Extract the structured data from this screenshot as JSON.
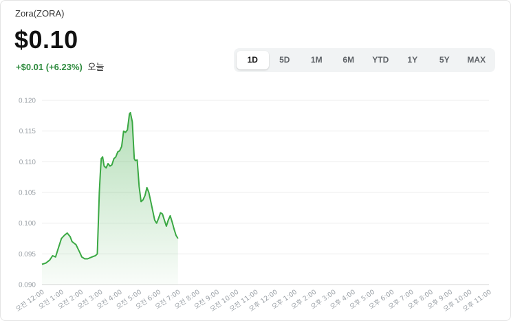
{
  "header": {
    "asset_name": "Zora(ZORA)",
    "price": "$0.10",
    "change": "+$0.01 (+6.23%)",
    "period_label": "오늘"
  },
  "range_tabs": [
    {
      "label": "1D",
      "active": true
    },
    {
      "label": "5D",
      "active": false
    },
    {
      "label": "1M",
      "active": false
    },
    {
      "label": "6M",
      "active": false
    },
    {
      "label": "YTD",
      "active": false
    },
    {
      "label": "1Y",
      "active": false
    },
    {
      "label": "5Y",
      "active": false
    },
    {
      "label": "MAX",
      "active": false
    }
  ],
  "colors": {
    "line": "#3aa843",
    "fill_top": "#3aa843",
    "grid": "#ececec",
    "tick": "#9aa0a6"
  },
  "chart_data": {
    "type": "area",
    "xlabel": "",
    "ylabel": "",
    "ylim": [
      0.09,
      0.12
    ],
    "grid": true,
    "yticks": [
      "0.120",
      "0.115",
      "0.110",
      "0.105",
      "0.100",
      "0.095",
      "0.090"
    ],
    "xticks": [
      "오전 12:00",
      "오전 1:00",
      "오전 2:00",
      "오전 3:00",
      "오전 4:00",
      "오전 5:00",
      "오전 6:00",
      "오전 7:00",
      "오전 8:00",
      "오전 9:00",
      "오전 10:00",
      "오전 11:00",
      "오후 12:00",
      "오후 1:00",
      "오후 2:00",
      "오후 3:00",
      "오후 4:00",
      "오후 5:00",
      "오후 6:00",
      "오후 7:00",
      "오후 8:00",
      "오후 9:00",
      "오후 10:00",
      "오후 11:00"
    ],
    "x_hours": [
      0,
      0.2,
      0.4,
      0.55,
      0.7,
      0.85,
      1.0,
      1.15,
      1.3,
      1.45,
      1.55,
      1.75,
      1.95,
      2.05,
      2.2,
      2.35,
      2.5,
      2.65,
      2.75,
      2.85,
      2.95,
      3.0,
      3.05,
      3.12,
      3.2,
      3.3,
      3.4,
      3.5,
      3.6,
      3.7,
      3.8,
      3.9,
      4.0,
      4.1,
      4.2,
      4.3,
      4.4,
      4.5,
      4.55,
      4.65,
      4.75,
      4.8,
      4.9,
      5.0,
      5.1,
      5.2,
      5.3,
      5.4,
      5.5,
      5.6,
      5.7,
      5.8,
      5.9,
      6.0,
      6.1,
      6.2,
      6.3,
      6.4,
      6.5,
      6.6,
      6.7,
      6.8,
      6.9,
      7.0
    ],
    "values": [
      0.0933,
      0.0935,
      0.094,
      0.0947,
      0.0945,
      0.096,
      0.0975,
      0.098,
      0.0984,
      0.0978,
      0.097,
      0.0965,
      0.0952,
      0.0945,
      0.0942,
      0.0942,
      0.0944,
      0.0946,
      0.0947,
      0.095,
      0.105,
      0.108,
      0.1105,
      0.1108,
      0.1093,
      0.109,
      0.1097,
      0.1093,
      0.1095,
      0.1105,
      0.1108,
      0.1116,
      0.1118,
      0.1125,
      0.115,
      0.1148,
      0.1152,
      0.1178,
      0.118,
      0.1165,
      0.1105,
      0.1102,
      0.1103,
      0.106,
      0.1035,
      0.1038,
      0.1045,
      0.1058,
      0.105,
      0.1035,
      0.102,
      0.1005,
      0.1,
      0.1008,
      0.1017,
      0.1015,
      0.1005,
      0.0995,
      0.1005,
      0.1012,
      0.1002,
      0.099,
      0.098,
      0.0975
    ]
  }
}
